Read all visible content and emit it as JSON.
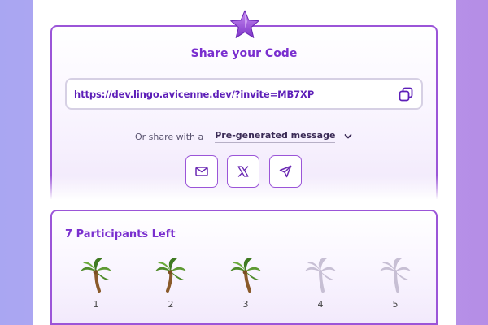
{
  "share": {
    "title": "Share your Code",
    "invite_url": "https://dev.lingo.avicenne.dev/?invite=MB7XP",
    "or_label": "Or share with a",
    "message_option": "Pre-generated message",
    "buttons": [
      {
        "icon": "mail-icon"
      },
      {
        "icon": "x-logo-icon"
      },
      {
        "icon": "send-icon"
      }
    ]
  },
  "participants": {
    "title": "7 Participants Left",
    "slots": [
      {
        "number": "1",
        "filled": true
      },
      {
        "number": "2",
        "filled": true
      },
      {
        "number": "3",
        "filled": true
      },
      {
        "number": "4",
        "filled": false
      },
      {
        "number": "5",
        "filled": false
      }
    ]
  },
  "colors": {
    "accent": "#9b55d8",
    "title": "#7a2fcf",
    "link": "#5d1fb8",
    "empty_slot": "#c7bfd4"
  }
}
